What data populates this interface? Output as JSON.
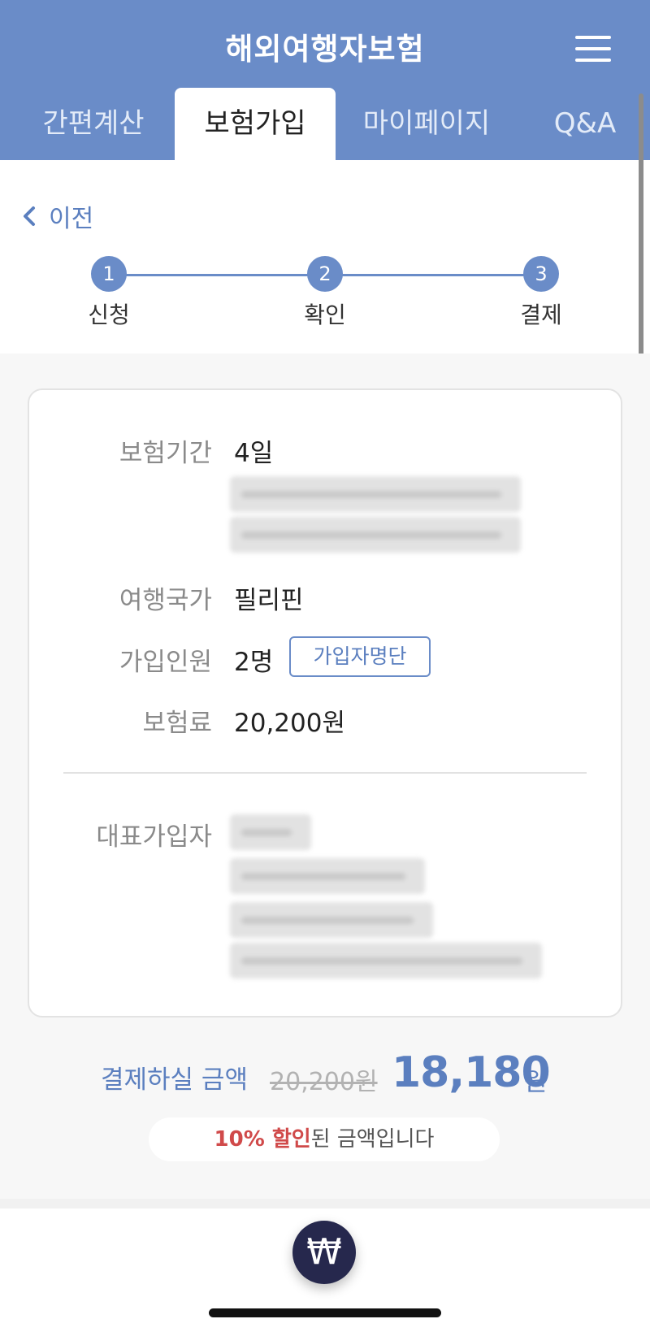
{
  "header": {
    "title": "해외여행자보험",
    "tabs": [
      {
        "label": "간편계산"
      },
      {
        "label": "보험가입"
      },
      {
        "label": "마이페이지"
      },
      {
        "label": "Q&A"
      }
    ]
  },
  "nav": {
    "back_label": "이전"
  },
  "stepper": {
    "steps": [
      {
        "number": "1",
        "label": "신청"
      },
      {
        "number": "2",
        "label": "확인"
      },
      {
        "number": "3",
        "label": "결제"
      }
    ]
  },
  "summary": {
    "period_label": "보험기간",
    "period_value": "4일",
    "country_label": "여행국가",
    "country_value": "필리핀",
    "members_label": "가입인원",
    "members_value": "2명",
    "members_button": "가입자명단",
    "premium_label": "보험료",
    "premium_value": "20,200원",
    "holder_label": "대표가입자"
  },
  "payment": {
    "label": "결제하실 금액",
    "original": "20,200원",
    "final": "18,180",
    "unit": "원",
    "discount_highlight": "10% 할인",
    "discount_rest": "된 금액입니다"
  },
  "bottom": {
    "pay_icon": "₩"
  },
  "colors": {
    "accent": "#6a8cc8",
    "dark_button": "#26284d",
    "discount": "#d04a4a"
  }
}
